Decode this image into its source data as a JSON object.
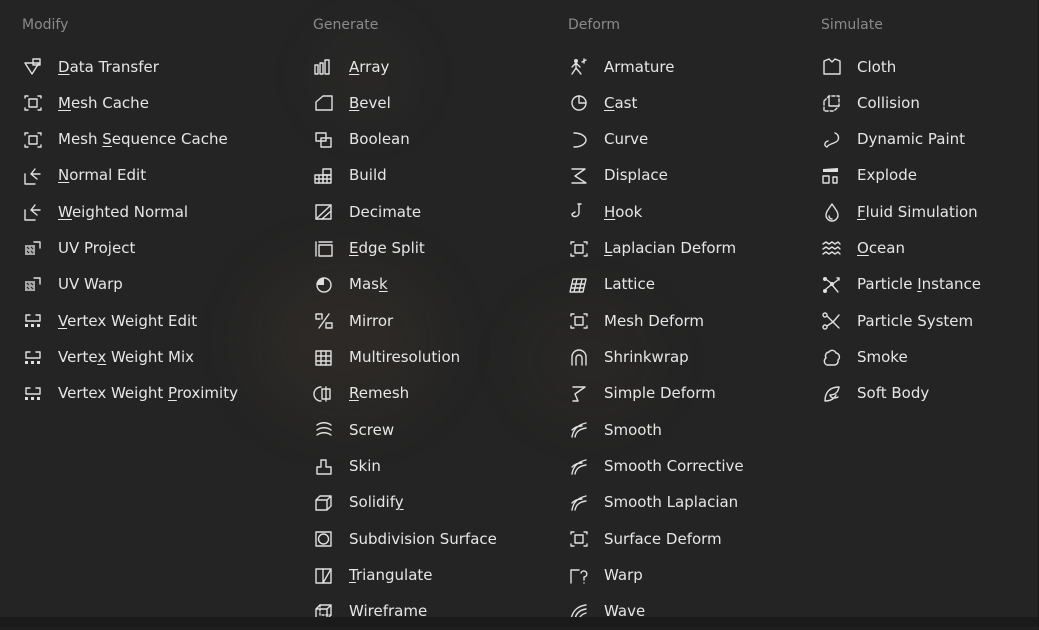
{
  "columns": [
    {
      "title": "Modify",
      "items": [
        {
          "label": "Data Transfer",
          "icon": "data-transfer-icon",
          "u": 0
        },
        {
          "label": "Mesh Cache",
          "icon": "mesh-cache-icon",
          "u": 0
        },
        {
          "label": "Mesh Sequence Cache",
          "icon": "mesh-sequence-cache-icon",
          "u": 5
        },
        {
          "label": "Normal Edit",
          "icon": "normal-edit-icon",
          "u": 0
        },
        {
          "label": "Weighted Normal",
          "icon": "weighted-normal-icon",
          "u": 0
        },
        {
          "label": "UV Project",
          "icon": "uv-project-icon",
          "u": -1
        },
        {
          "label": "UV Warp",
          "icon": "uv-warp-icon",
          "u": -1
        },
        {
          "label": "Vertex Weight Edit",
          "icon": "vertex-weight-edit-icon",
          "u": 0
        },
        {
          "label": "Vertex Weight Mix",
          "icon": "vertex-weight-mix-icon",
          "u": 5
        },
        {
          "label": "Vertex Weight Proximity",
          "icon": "vertex-weight-proximity-icon",
          "u": 14
        }
      ]
    },
    {
      "title": "Generate",
      "items": [
        {
          "label": "Array",
          "icon": "array-icon",
          "u": 0
        },
        {
          "label": "Bevel",
          "icon": "bevel-icon",
          "u": 0
        },
        {
          "label": "Boolean",
          "icon": "boolean-icon",
          "u": -1
        },
        {
          "label": "Build",
          "icon": "build-icon",
          "u": -1
        },
        {
          "label": "Decimate",
          "icon": "decimate-icon",
          "u": -1
        },
        {
          "label": "Edge Split",
          "icon": "edge-split-icon",
          "u": 0
        },
        {
          "label": "Mask",
          "icon": "mask-icon",
          "u": 3
        },
        {
          "label": "Mirror",
          "icon": "mirror-icon",
          "u": -1
        },
        {
          "label": "Multiresolution",
          "icon": "multiresolution-icon",
          "u": -1
        },
        {
          "label": "Remesh",
          "icon": "remesh-icon",
          "u": 0
        },
        {
          "label": "Screw",
          "icon": "screw-icon",
          "u": -1
        },
        {
          "label": "Skin",
          "icon": "skin-icon",
          "u": -1
        },
        {
          "label": "Solidify",
          "icon": "solidify-icon",
          "u": 7
        },
        {
          "label": "Subdivision Surface",
          "icon": "subdivision-surface-icon",
          "u": -1
        },
        {
          "label": "Triangulate",
          "icon": "triangulate-icon",
          "u": 0
        },
        {
          "label": "Wireframe",
          "icon": "wireframe-icon",
          "u": -1
        }
      ]
    },
    {
      "title": "Deform",
      "items": [
        {
          "label": "Armature",
          "icon": "armature-icon",
          "u": -1
        },
        {
          "label": "Cast",
          "icon": "cast-icon",
          "u": 0
        },
        {
          "label": "Curve",
          "icon": "curve-icon",
          "u": -1
        },
        {
          "label": "Displace",
          "icon": "displace-icon",
          "u": -1
        },
        {
          "label": "Hook",
          "icon": "hook-icon",
          "u": 0
        },
        {
          "label": "Laplacian Deform",
          "icon": "laplacian-deform-icon",
          "u": 0
        },
        {
          "label": "Lattice",
          "icon": "lattice-icon",
          "u": -1
        },
        {
          "label": "Mesh Deform",
          "icon": "mesh-deform-icon",
          "u": -1
        },
        {
          "label": "Shrinkwrap",
          "icon": "shrinkwrap-icon",
          "u": -1
        },
        {
          "label": "Simple Deform",
          "icon": "simple-deform-icon",
          "u": -1
        },
        {
          "label": "Smooth",
          "icon": "smooth-icon",
          "u": -1
        },
        {
          "label": "Smooth Corrective",
          "icon": "smooth-corrective-icon",
          "u": -1
        },
        {
          "label": "Smooth Laplacian",
          "icon": "smooth-laplacian-icon",
          "u": -1
        },
        {
          "label": "Surface Deform",
          "icon": "surface-deform-icon",
          "u": -1
        },
        {
          "label": "Warp",
          "icon": "warp-icon",
          "u": -1
        },
        {
          "label": "Wave",
          "icon": "wave-icon",
          "u": -1
        }
      ]
    },
    {
      "title": "Simulate",
      "items": [
        {
          "label": "Cloth",
          "icon": "cloth-icon",
          "u": -1
        },
        {
          "label": "Collision",
          "icon": "collision-icon",
          "u": -1
        },
        {
          "label": "Dynamic Paint",
          "icon": "dynamic-paint-icon",
          "u": -1
        },
        {
          "label": "Explode",
          "icon": "explode-icon",
          "u": -1
        },
        {
          "label": "Fluid Simulation",
          "icon": "fluid-simulation-icon",
          "u": 0
        },
        {
          "label": "Ocean",
          "icon": "ocean-icon",
          "u": 0
        },
        {
          "label": "Particle Instance",
          "icon": "particle-instance-icon",
          "u": 9
        },
        {
          "label": "Particle System",
          "icon": "particle-system-icon",
          "u": -1
        },
        {
          "label": "Smoke",
          "icon": "smoke-icon",
          "u": -1
        },
        {
          "label": "Soft Body",
          "icon": "soft-body-icon",
          "u": -1
        }
      ]
    }
  ],
  "colors": {
    "background": "#242424",
    "title": "#8a8a8a",
    "label": "#e6e6e6",
    "icon": "#e0e0e0"
  }
}
